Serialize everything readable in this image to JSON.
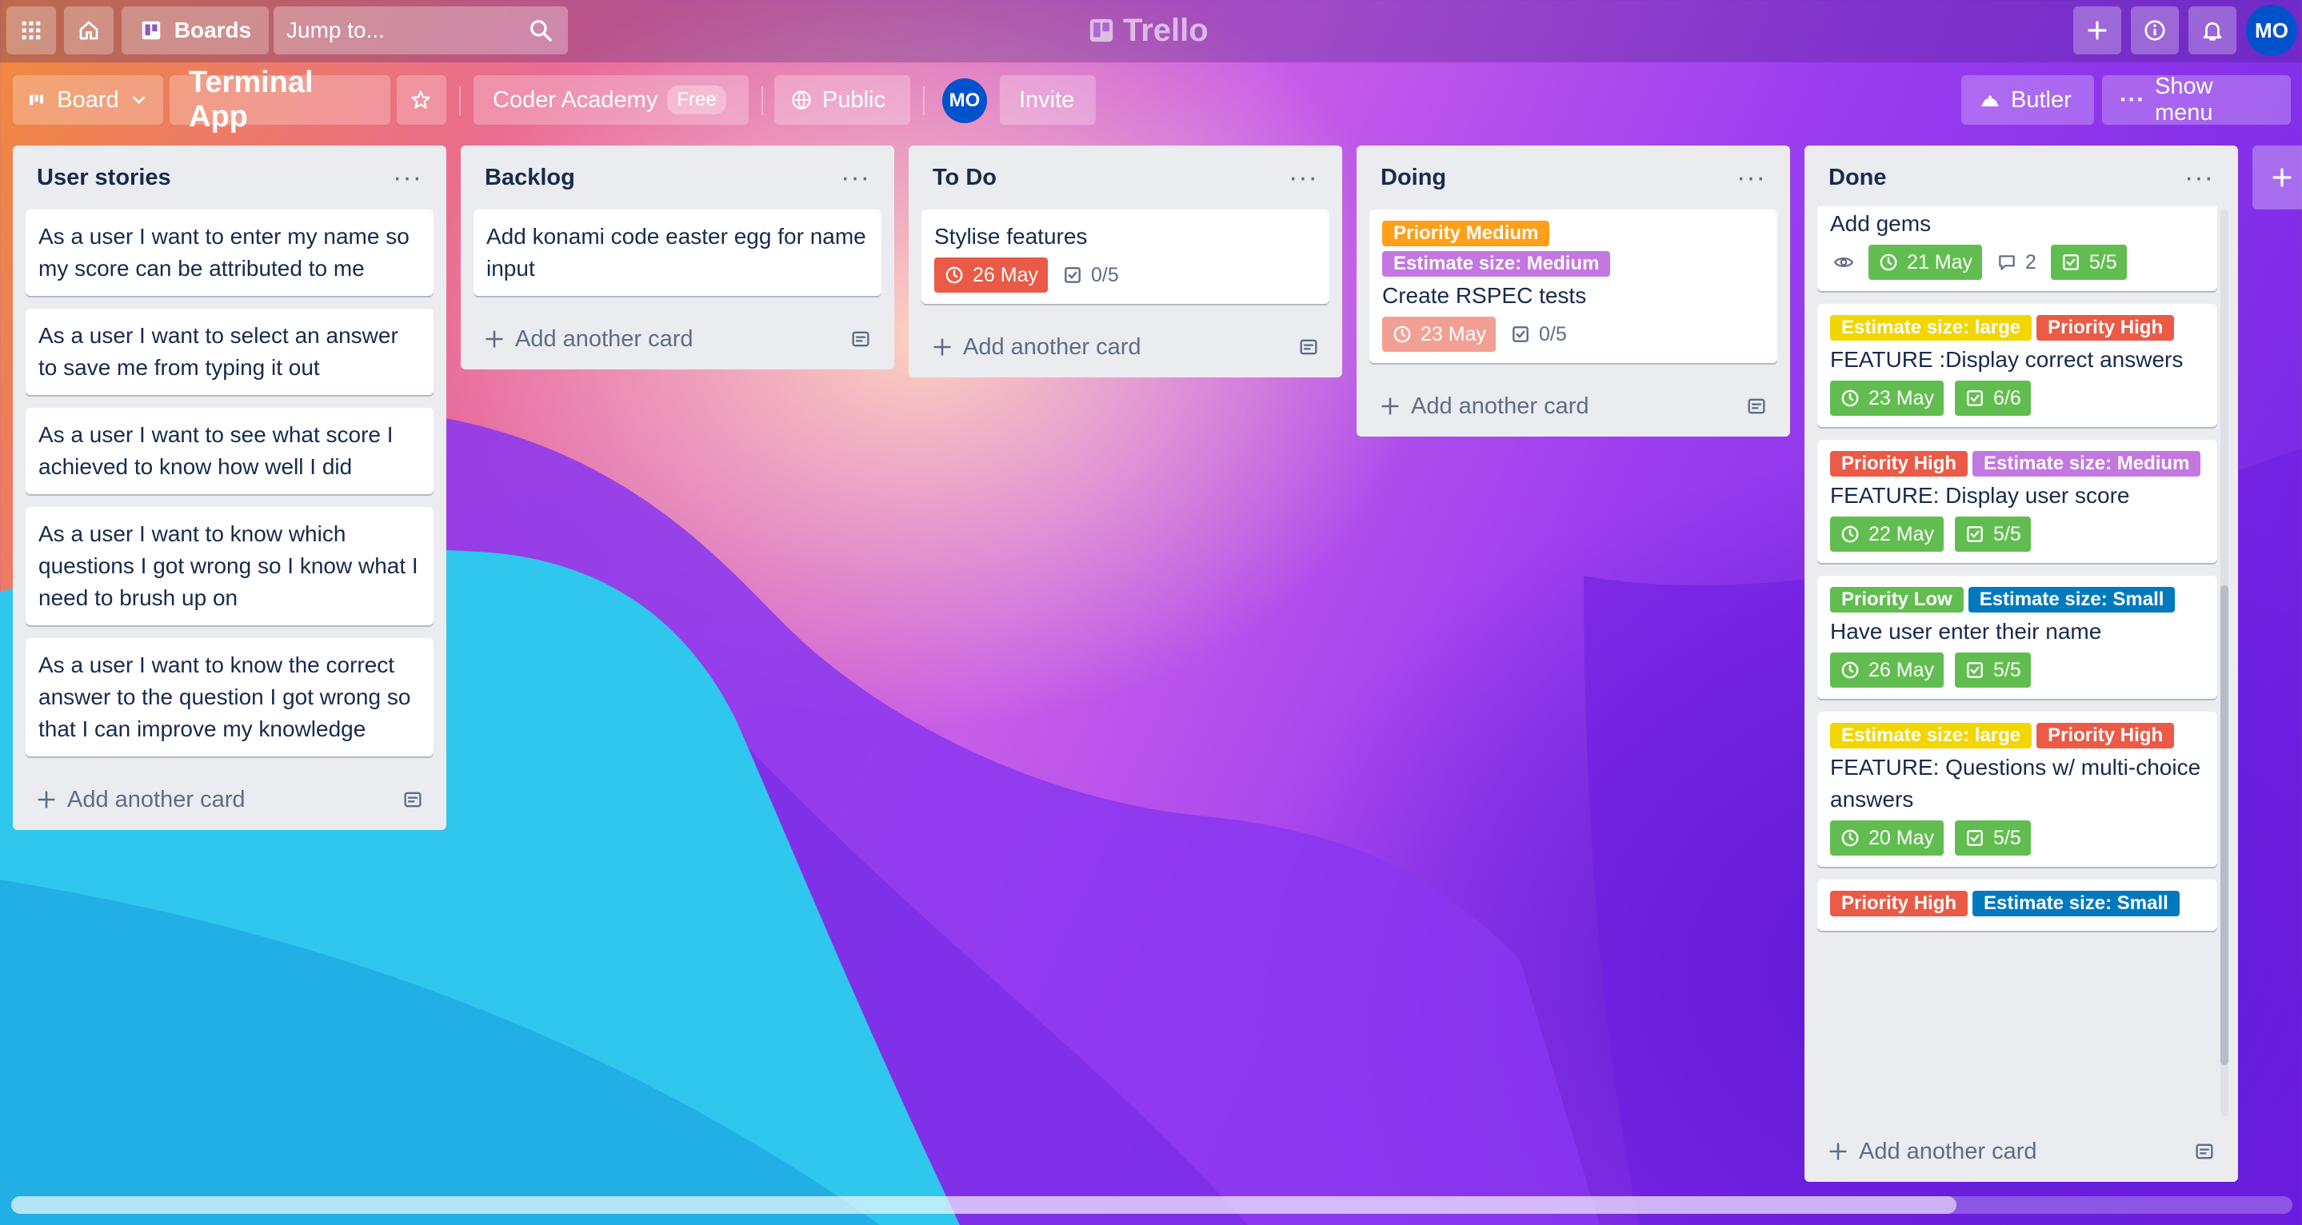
{
  "topbar": {
    "boards_label": "Boards",
    "search_placeholder": "Jump to...",
    "logo_text": "Trello",
    "avatar_initials": "MO"
  },
  "boardbar": {
    "view_label": "Board",
    "board_title": "Terminal App",
    "workspace": "Coder Academy",
    "plan": "Free",
    "visibility": "Public",
    "member_initials": "MO",
    "invite_label": "Invite",
    "butler_label": "Butler",
    "show_menu_label": "Show menu"
  },
  "colors": {
    "label_orange": "#ff9f1a",
    "label_purple": "#c377e0",
    "label_yellow": "#f2d600",
    "label_red": "#eb5a46",
    "label_green": "#61bd4f",
    "label_blue": "#0079bf",
    "avatar_blue": "#0052cc"
  },
  "lists": [
    {
      "title": "User stories",
      "add_label": "Add another card",
      "cards": [
        {
          "title": "As a user I want to enter my name so my score can be attributed to me"
        },
        {
          "title": "As a user I want to select an answer to save me from typing it out"
        },
        {
          "title": "As a user I want to see what score I achieved to know how well I did"
        },
        {
          "title": "As a user I want to know which questions I got wrong so I know what I need to brush up on"
        },
        {
          "title": "As a user I want to know the correct answer to the question I got wrong so that I can improve my knowledge"
        }
      ]
    },
    {
      "title": "Backlog",
      "add_label": "Add another card",
      "cards": [
        {
          "title": "Add konami code easter egg for name input"
        }
      ]
    },
    {
      "title": "To Do",
      "add_label": "Add another card",
      "cards": [
        {
          "title": "Stylise features",
          "due": "26 May",
          "due_style": "red",
          "checklist": "0/5"
        }
      ]
    },
    {
      "title": "Doing",
      "add_label": "Add another card",
      "cards": [
        {
          "labels": [
            {
              "text": "Priority Medium",
              "color": "label_orange"
            },
            {
              "text": "Estimate size: Medium",
              "color": "label_purple"
            }
          ],
          "title": "Create RSPEC tests",
          "due": "23 May",
          "due_style": "pink",
          "checklist": "0/5"
        }
      ]
    },
    {
      "title": "Done",
      "add_label": "Add another card",
      "cards": [
        {
          "title": "Add gems",
          "watch": true,
          "due": "21 May",
          "comments": "2",
          "checklist": "5/5"
        },
        {
          "labels": [
            {
              "text": "Estimate size: large",
              "color": "label_yellow"
            },
            {
              "text": "Priority High",
              "color": "label_red"
            }
          ],
          "title": "FEATURE :Display correct answers",
          "due": "23 May",
          "checklist": "6/6"
        },
        {
          "labels": [
            {
              "text": "Priority High",
              "color": "label_red"
            },
            {
              "text": "Estimate size: Medium",
              "color": "label_purple"
            }
          ],
          "title": "FEATURE: Display user score",
          "due": "22 May",
          "checklist": "5/5"
        },
        {
          "labels": [
            {
              "text": "Priority Low",
              "color": "label_green"
            },
            {
              "text": "Estimate size: Small",
              "color": "label_blue"
            }
          ],
          "title": "Have user enter their name",
          "due": "26 May",
          "checklist": "5/5"
        },
        {
          "labels": [
            {
              "text": "Estimate size: large",
              "color": "label_yellow"
            },
            {
              "text": "Priority High",
              "color": "label_red"
            }
          ],
          "title": "FEATURE: Questions w/ multi-choice answers",
          "due": "20 May",
          "checklist": "5/5"
        },
        {
          "labels": [
            {
              "text": "Priority High",
              "color": "label_red"
            },
            {
              "text": "Estimate size: Small",
              "color": "label_blue"
            }
          ],
          "title": ""
        }
      ]
    }
  ]
}
